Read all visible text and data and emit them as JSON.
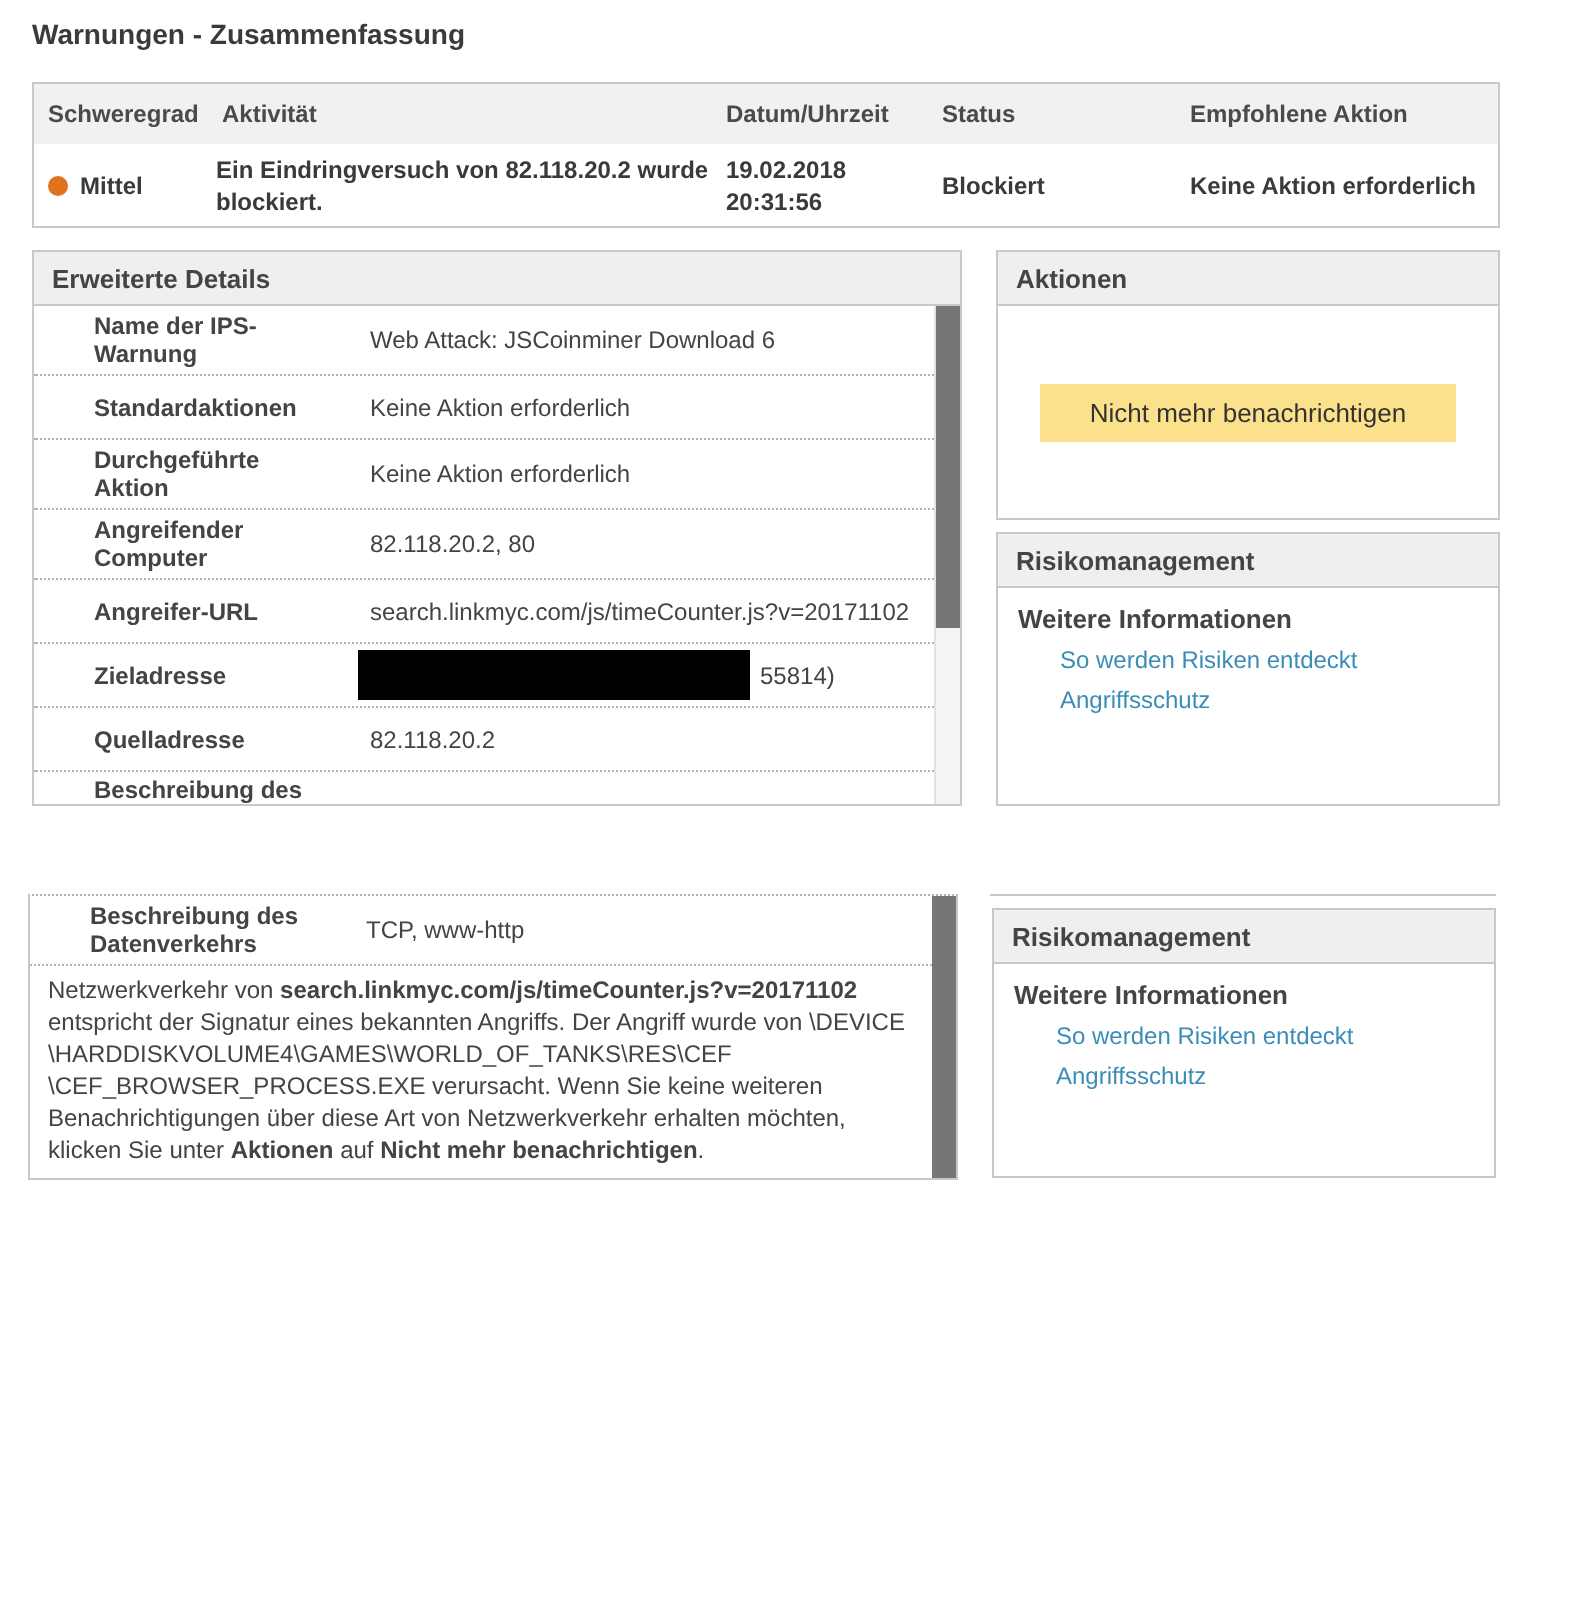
{
  "title": "Warnungen - Zusammenfassung",
  "summary": {
    "columns": [
      "Schweregrad",
      "Aktivität",
      "Datum/Uhrzeit",
      "Status",
      "Empfohlene Aktion"
    ],
    "rows": [
      {
        "severity": "Mittel",
        "color": "#e2711d",
        "activity": "Ein Eindringversuch von 82.118.20.2 wurde blockiert.",
        "datetime": "19.02.2018 20:31:56",
        "status": "Blockiert",
        "recommended_action": "Keine Aktion erforderlich"
      }
    ]
  },
  "details": {
    "title": "Erweiterte Details",
    "rows": [
      {
        "label": "Name der IPS-Warnung",
        "value": "Web Attack: JSCoinminer Download 6"
      },
      {
        "label": "Standardaktionen",
        "value": "Keine Aktion erforderlich"
      },
      {
        "label": "Durchgeführte Aktion",
        "value": "Keine Aktion erforderlich"
      },
      {
        "label": "Angreifender Computer",
        "value": "82.118.20.2, 80"
      },
      {
        "label": "Angreifer-URL",
        "value": "search.linkmyc.com/js/timeCounter.js?v=20171102"
      },
      {
        "label": "Zieladresse",
        "value": "55814)",
        "redacted": true
      },
      {
        "label": "Quelladresse",
        "value": "82.118.20.2"
      },
      {
        "label": "Beschreibung des"
      }
    ]
  },
  "actions": {
    "title": "Aktionen",
    "button": "Nicht mehr benachrichtigen"
  },
  "risk": {
    "title": "Risikomanagement",
    "subtitle": "Weitere Informationen",
    "links": [
      "So werden Risiken entdeckt",
      "Angriffsschutz"
    ]
  },
  "details_continued": {
    "rows": [
      {
        "label": "Beschreibung des Datenverkehrs",
        "value": "TCP, www-http"
      }
    ],
    "description": "Netzwerkverkehr von **search.linkmyc.com/js/timeCounter.js?v=20171102**\nentspricht der Signatur eines bekannten Angriffs. Der Angriff wurde von \\DEVICE\n\\HARDDISKVOLUME4\\GAMES\\WORLD_OF_TANKS\\RES\\CEF\n\\CEF_BROWSER_PROCESS.EXE verursacht. Wenn Sie keine weiteren\nBenachrichtigungen über diese Art von Netzwerkverkehr erhalten möchten,\nklicken Sie unter **Aktionen** auf **Nicht mehr benachrichtigen**."
  },
  "risk_continued": {
    "title": "Risikomanagement",
    "subtitle": "Weitere Informationen",
    "links": [
      "So werden Risiken entdeckt",
      "Angriffsschutz"
    ]
  }
}
